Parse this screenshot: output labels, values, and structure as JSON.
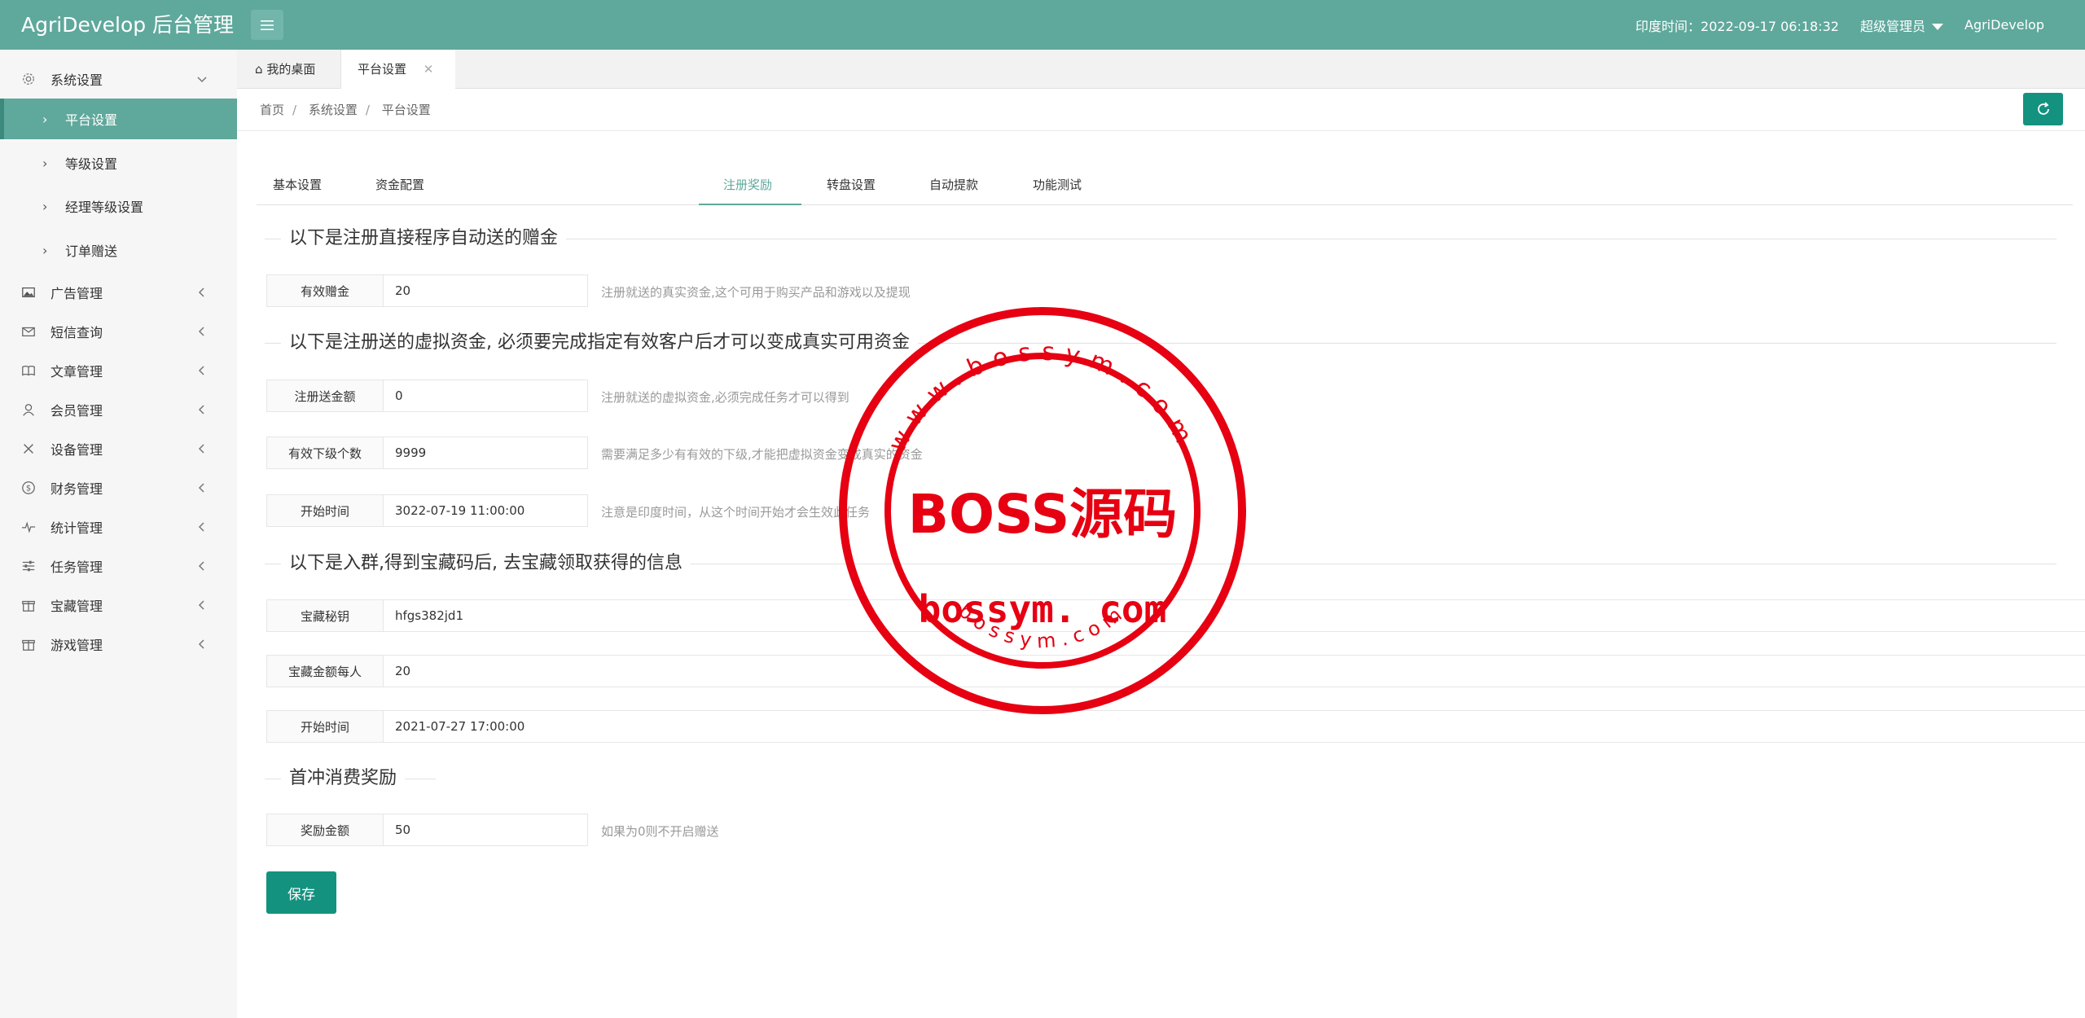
{
  "app": {
    "title": "AgriDevelop 后台管理",
    "time_label": "印度时间：2022-09-17 06:18:32",
    "role_label": "超级管理员",
    "username": "AgriDevelop"
  },
  "sidebar": {
    "groups": [
      {
        "label": "系统设置",
        "icon": "gear-icon"
      },
      {
        "label": "广告管理",
        "icon": "image-icon"
      },
      {
        "label": "短信查询",
        "icon": "mail-icon"
      },
      {
        "label": "文章管理",
        "icon": "book-icon"
      },
      {
        "label": "会员管理",
        "icon": "user-icon"
      },
      {
        "label": "设备管理",
        "icon": "tools-icon"
      },
      {
        "label": "财务管理",
        "icon": "dollar-icon"
      },
      {
        "label": "统计管理",
        "icon": "pulse-icon"
      },
      {
        "label": "任务管理",
        "icon": "sliders-icon"
      },
      {
        "label": "宝藏管理",
        "icon": "gift-icon"
      },
      {
        "label": "游戏管理",
        "icon": "gift-icon"
      }
    ],
    "sub_items": [
      "平台设置",
      "等级设置",
      "经理等级设置",
      "订单赠送"
    ]
  },
  "tabs": {
    "home": "我的桌面",
    "current": "平台设置"
  },
  "breadcrumb": [
    "首页",
    "系统设置",
    "平台设置"
  ],
  "subtabs": [
    "基本设置",
    "资金配置",
    "注册奖励",
    "转盘设置",
    "自动提款",
    "功能测试"
  ],
  "sections": {
    "s1": "以下是注册直接程序自动送的赠金",
    "s2": "以下是注册送的虚拟资金, 必须要完成指定有效客户后才可以变成真实可用资金",
    "s3": "以下是入群,得到宝藏码后, 去宝藏领取获得的信息",
    "s4": "首冲消费奖励"
  },
  "fields": {
    "valid_bonus": {
      "label": "有效赠金",
      "value": "20",
      "hint": "注册就送的真实资金,这个可用于购买产品和游戏以及提现"
    },
    "reg_amount": {
      "label": "注册送金额",
      "value": "0",
      "hint": "注册就送的虚拟资金,必须完成任务才可以得到"
    },
    "valid_sub": {
      "label": "有效下级个数",
      "value": "9999",
      "hint": "需要满足多少有有效的下级,才能把虚拟资金变成真实的资金"
    },
    "start_time": {
      "label": "开始时间",
      "value": "3022-07-19 11:00:00",
      "hint": "注意是印度时间，从这个时间开始才会生效此任务"
    },
    "treasure_key": {
      "label": "宝藏秘钥",
      "value": "hfgs382jd1"
    },
    "treasure_amount": {
      "label": "宝藏金额每人",
      "value": "20"
    },
    "treasure_start": {
      "label": "开始时间",
      "value": "2021-07-27 17:00:00"
    },
    "reward_amount": {
      "label": "奖励金额",
      "value": "50",
      "hint": "如果为0则不开启赠送"
    }
  },
  "save_label": "保存",
  "watermark": {
    "main": "BOSS源码",
    "domain": "bossym. com",
    "ring_top": "www.bossym.com",
    "ring_bottom": "bossym.com",
    "color": "#e60012"
  },
  "colors": {
    "header": "#5fa89c",
    "accent": "#13927f"
  }
}
